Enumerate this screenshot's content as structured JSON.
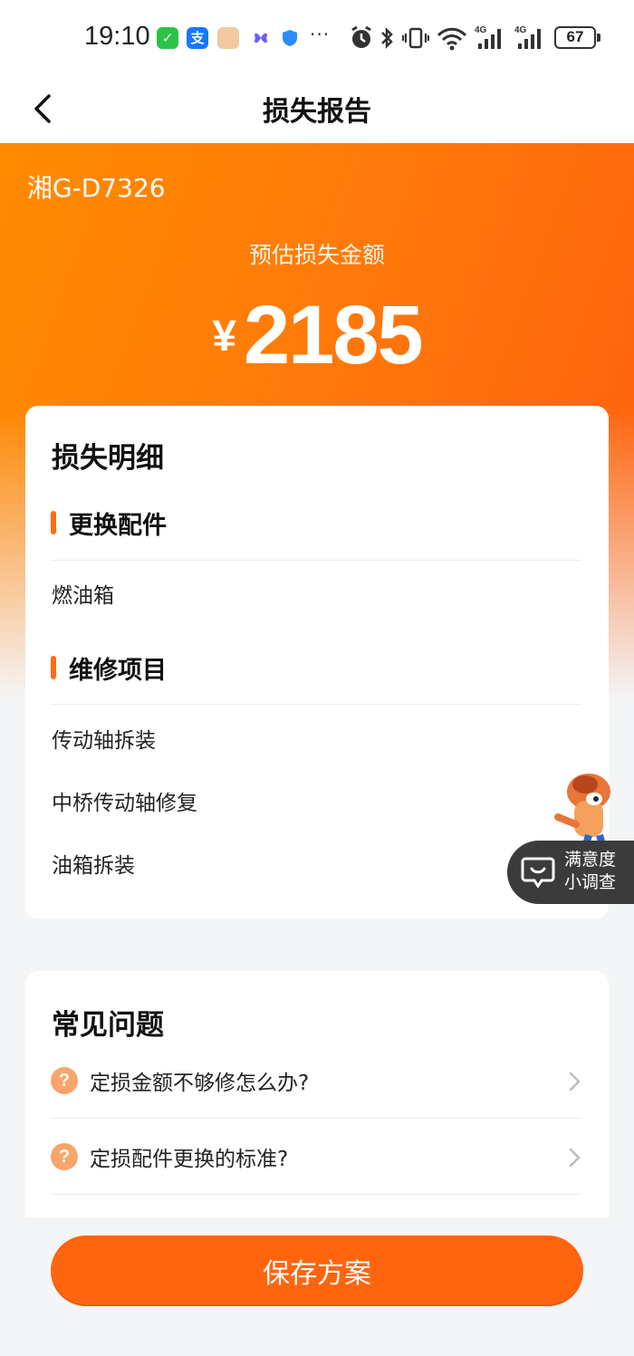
{
  "status_bar": {
    "time": "19:10",
    "network_1": "4G",
    "network_2": "4G",
    "battery": "67"
  },
  "nav": {
    "title": "损失报告"
  },
  "hero": {
    "plate": "湘G-D7326",
    "estimate_label": "预估损失金额",
    "currency": "¥",
    "amount": "2185"
  },
  "detail": {
    "title": "损失明细",
    "sections": [
      {
        "label": "更换配件",
        "items": [
          "燃油箱"
        ]
      },
      {
        "label": "维修项目",
        "items": [
          "传动轴拆装",
          "中桥传动轴修复",
          "油箱拆装"
        ]
      }
    ]
  },
  "faq": {
    "title": "常见问题",
    "icon_glyph": "?",
    "items": [
      "定损金额不够修怎么办?",
      "定损配件更换的标准?"
    ]
  },
  "survey": {
    "line1": "满意度",
    "line2": "小调查"
  },
  "actions": {
    "save_label": "保存方案"
  },
  "colors": {
    "accent": "#ff650f",
    "hero_start": "#ff8c00",
    "hero_end": "#ff5f10"
  }
}
